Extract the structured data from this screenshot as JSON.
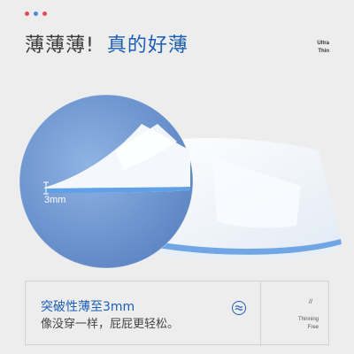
{
  "theme": {
    "accent": "#1a5fb4",
    "dot_colors": [
      "#e24c5a",
      "#4a8ad9",
      "#e24c5a"
    ]
  },
  "headline": {
    "part1": "薄薄薄!",
    "part2": "真的好薄"
  },
  "side_tag": {
    "line1": "Ultra",
    "line2": "Thin"
  },
  "hero": {
    "thickness_label": "3mm"
  },
  "info": {
    "title": "突破性薄至3mm",
    "subtitle": "像没穿一样，屁屁更轻松。",
    "icon": "wave-circle-icon",
    "slashes": "//",
    "tag_line1": "Thinning",
    "tag_line2": "Free"
  }
}
